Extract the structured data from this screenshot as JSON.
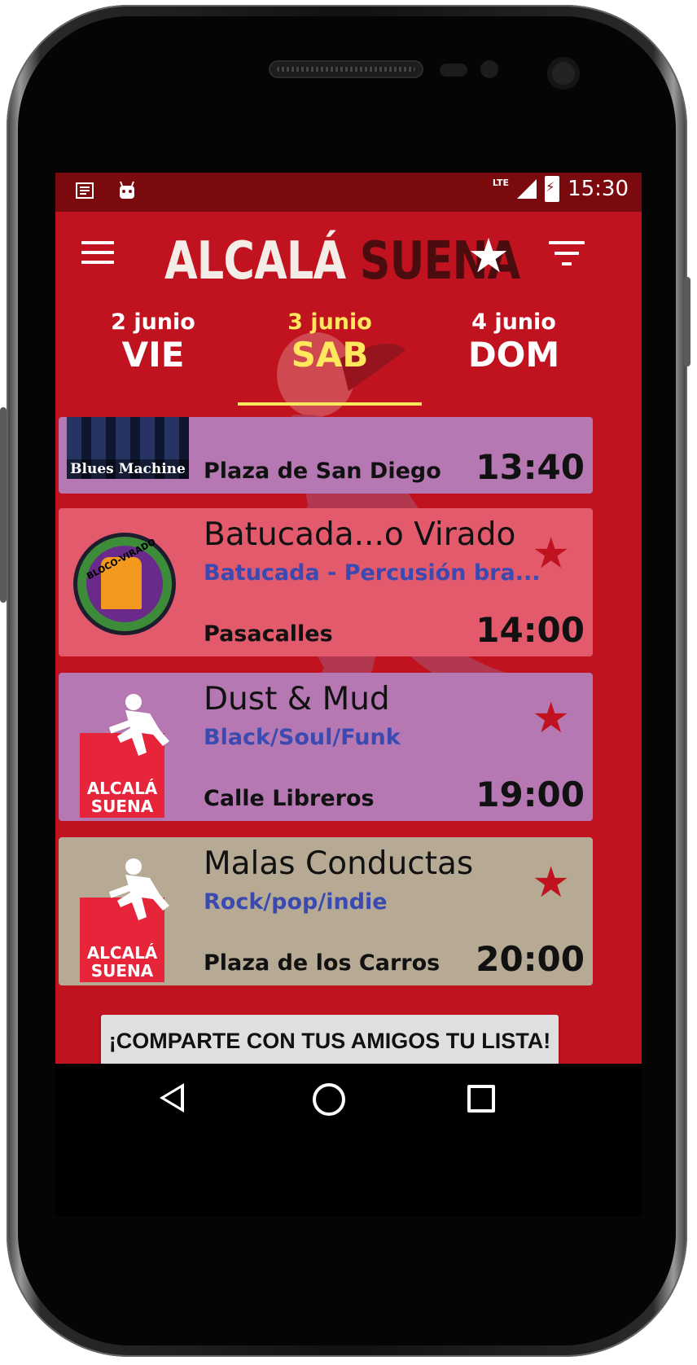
{
  "status_bar": {
    "network": "LTE",
    "time": "15:30"
  },
  "header": {
    "logo_part1": "ALCALÁ",
    "logo_part2": "SUENA"
  },
  "tabs": [
    {
      "date": "2 junio",
      "day": "VIE",
      "active": false
    },
    {
      "date": "3 junio",
      "day": "SAB",
      "active": true
    },
    {
      "date": "4 junio",
      "day": "DOM",
      "active": false
    }
  ],
  "events": [
    {
      "title": "",
      "genre": "",
      "venue": "Plaza de San Diego",
      "time": "13:40",
      "image_label": "Blues Machine",
      "color": "#b678b3"
    },
    {
      "title": "Batucada...o Virado",
      "genre": "Batucada - Percusión bra...",
      "venue": "Pasacalles",
      "time": "14:00",
      "image_label": "BLOCO-VIRADO",
      "color": "#e35a6c"
    },
    {
      "title": "Dust & Mud",
      "genre": "Black/Soul/Funk",
      "venue": "Calle Libreros",
      "time": "19:00",
      "image_label_1": "ALCALÁ",
      "image_label_2": "SUENA",
      "color": "#b678b3"
    },
    {
      "title": "Malas Conductas",
      "genre": "Rock/pop/indie",
      "venue": "Plaza de los Carros",
      "time": "20:00",
      "image_label_1": "ALCALÁ",
      "image_label_2": "SUENA",
      "color": "#b6aa95"
    }
  ],
  "share_button": "¡COMPARTE CON TUS AMIGOS TU LISTA!",
  "colors": {
    "app_background": "#c1121f",
    "status_bar": "#7b0a0e",
    "active_tab": "#ffe85c",
    "genre_text": "#3a4ab0"
  }
}
